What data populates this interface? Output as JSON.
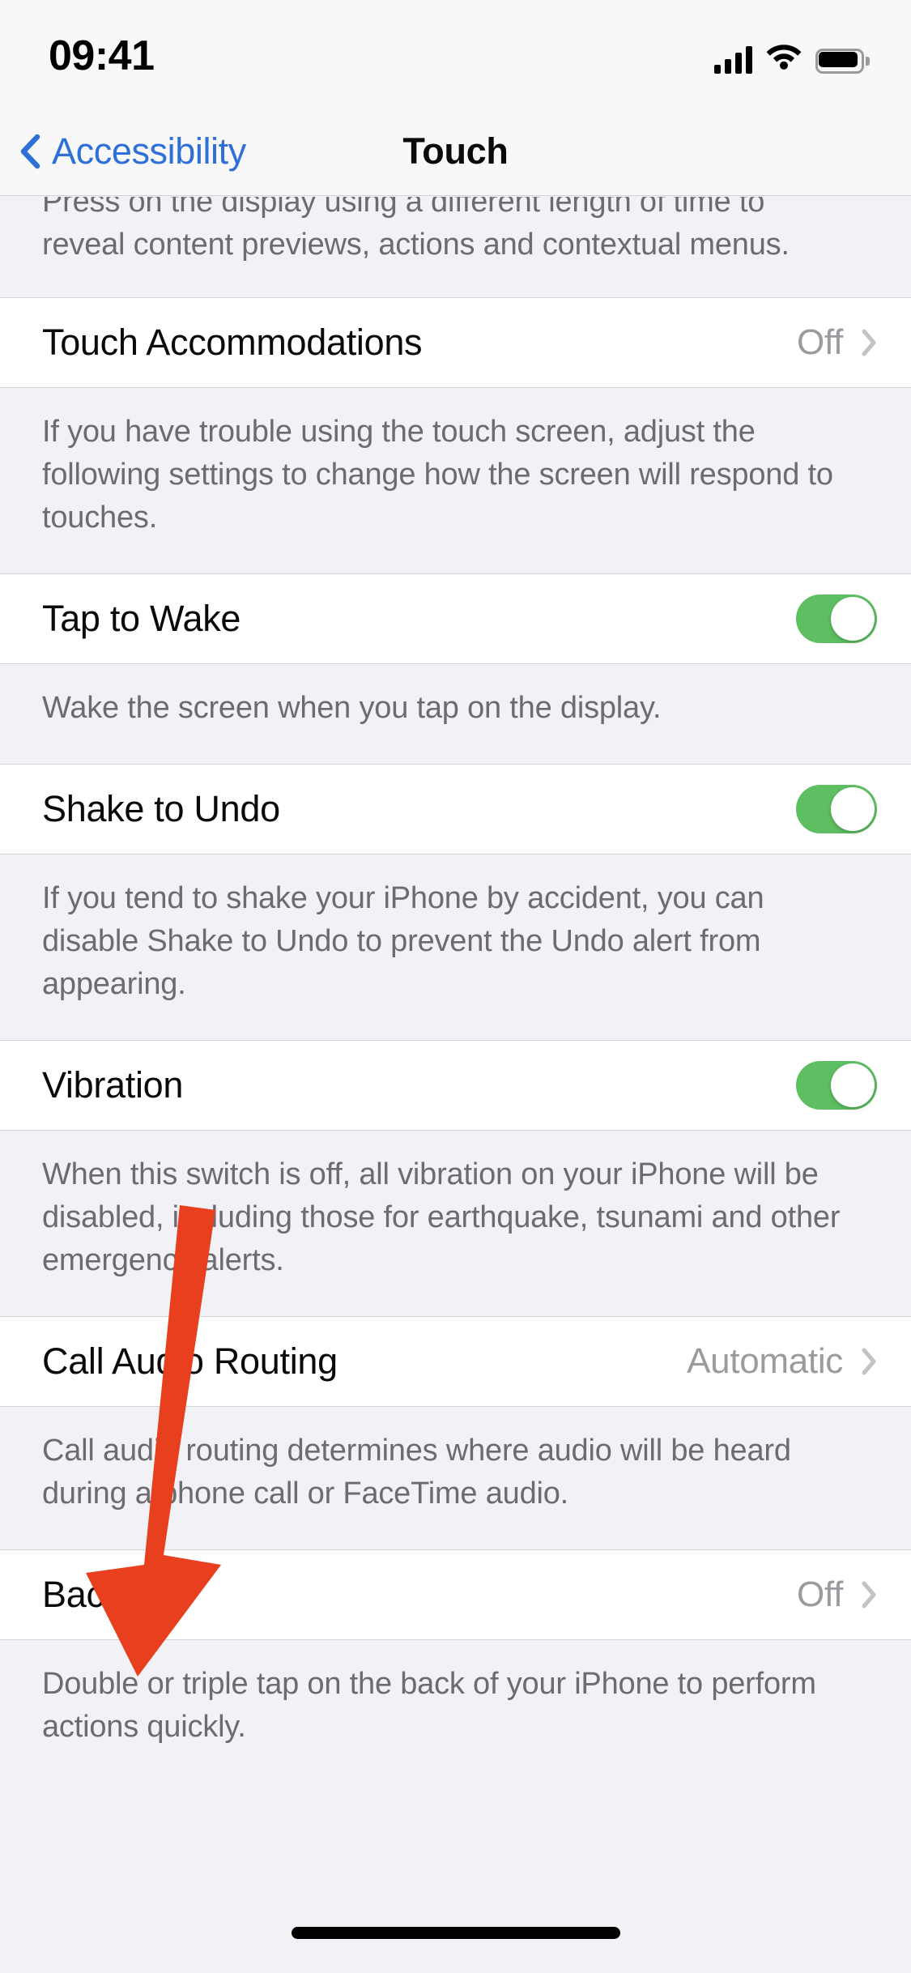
{
  "status_bar": {
    "time": "09:41",
    "cellular_icon": "cellular-signal-icon",
    "wifi_icon": "wifi-icon",
    "battery_icon": "battery-full-icon"
  },
  "nav_bar": {
    "back_label": "Accessibility",
    "back_icon": "chevron-left-icon",
    "title": "Touch"
  },
  "colors": {
    "accent_blue": "#2F6FD8",
    "toggle_on_green": "#5EBE62",
    "annotation_red": "#E8401F",
    "group_background": "#FFFFFF",
    "page_background": "#F2F1F6",
    "secondary_text": "#6C6C70",
    "value_text": "#9A9A9F"
  },
  "content": {
    "clipped_top_footer": "Press on the display using a different length of time to\nreveal content previews, actions and contextual menus.",
    "rows": [
      {
        "name": "touch-accommodations",
        "label": "Touch Accommodations",
        "type": "disclosure",
        "value": "Off",
        "chevron_icon": "chevron-right-icon",
        "footer": "If you have trouble using the touch screen, adjust the\nfollowing settings to change how the screen will respond to\ntouches."
      },
      {
        "name": "tap-to-wake",
        "label": "Tap to Wake",
        "type": "toggle",
        "value": "on",
        "footer": "Wake the screen when you tap on the display."
      },
      {
        "name": "shake-to-undo",
        "label": "Shake to Undo",
        "type": "toggle",
        "value": "on",
        "footer": "If you tend to shake your iPhone by accident, you can\ndisable Shake to Undo to prevent the Undo alert from\nappearing."
      },
      {
        "name": "vibration",
        "label": "Vibration",
        "type": "toggle",
        "value": "on",
        "footer": "When this switch is off, all vibration on your iPhone will be\ndisabled, including those for earthquake, tsunami and other\nemergency alerts."
      },
      {
        "name": "call-audio-routing",
        "label": "Call Audio Routing",
        "type": "disclosure",
        "value": "Automatic",
        "chevron_icon": "chevron-right-icon",
        "footer": "Call audio routing determines where audio will be heard\nduring a phone call or FaceTime audio."
      },
      {
        "name": "back-tap",
        "label": "Back Tap",
        "type": "disclosure",
        "value": "Off",
        "chevron_icon": "chevron-right-icon",
        "footer": "Double or triple tap on the back of your iPhone to perform\nactions quickly."
      }
    ]
  },
  "annotation": {
    "arrow_icon": "down-arrow-annotation",
    "points_at": "Back Tap"
  },
  "home_indicator": {
    "icon": "home-indicator-bar"
  }
}
